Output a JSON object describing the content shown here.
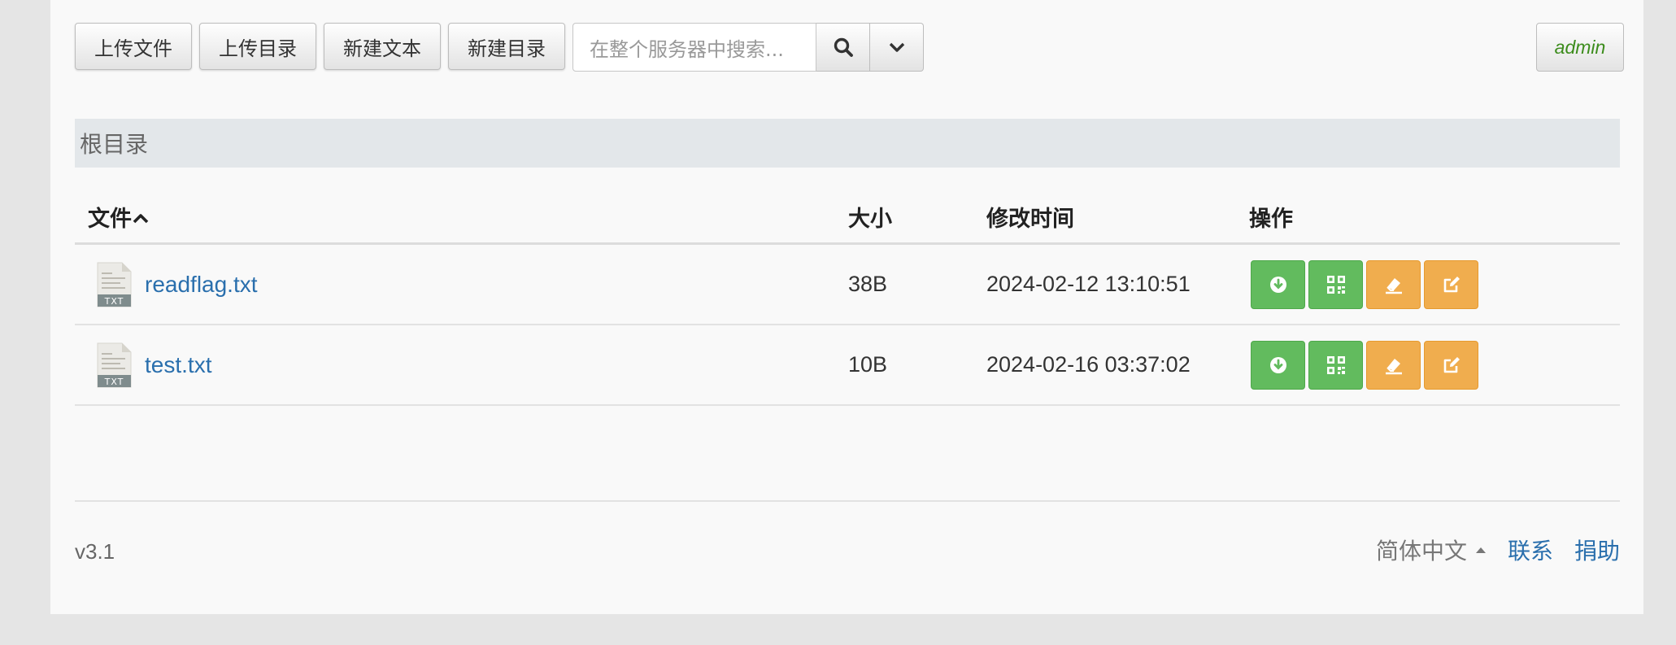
{
  "toolbar": {
    "buttons": [
      "上传文件",
      "上传目录",
      "新建文本",
      "新建目录"
    ],
    "search_placeholder": "在整个服务器中搜索...",
    "user": "admin"
  },
  "breadcrumb": "根目录",
  "table": {
    "headers": {
      "name": "文件",
      "size": "大小",
      "time": "修改时间",
      "ops": "操作"
    },
    "rows": [
      {
        "name": "readflag.txt",
        "size": "38B",
        "time": "2024-02-12 13:10:51",
        "icon_label": "TXT"
      },
      {
        "name": "test.txt",
        "size": "10B",
        "time": "2024-02-16 03:37:02",
        "icon_label": "TXT"
      }
    ]
  },
  "footer": {
    "version": "v3.1",
    "language": "简体中文",
    "contact": "联系",
    "donate": "捐助"
  },
  "colors": {
    "green": "#62bb5e",
    "orange": "#f0ad4e",
    "link": "#2a6fad"
  }
}
